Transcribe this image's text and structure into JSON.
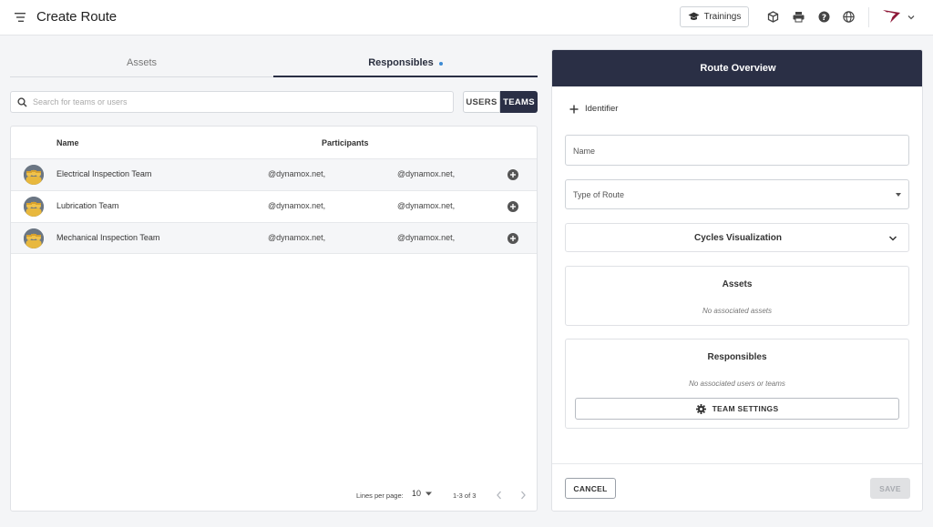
{
  "header": {
    "title": "Create Route",
    "trainings_label": "Trainings",
    "icons": [
      "menu-icon",
      "cube-icon",
      "printer-icon",
      "help-icon",
      "globe-icon",
      "brand-logo",
      "chevron-down-icon"
    ]
  },
  "left": {
    "tabs": [
      {
        "label": "Assets",
        "active": false
      },
      {
        "label": "Responsibles",
        "active": true
      }
    ],
    "search": {
      "placeholder": "Search for teams or users"
    },
    "toggle": {
      "users": "USERS",
      "teams": "TEAMS",
      "selected": "TEAMS"
    },
    "table": {
      "columns": {
        "name": "Name",
        "participants": "Participants"
      },
      "rows": [
        {
          "name": "Electrical Inspection Team",
          "participant_1": "@dynamox.net,",
          "participant_2": "@dynamox.net,"
        },
        {
          "name": "Lubrication Team",
          "participant_1": "@dynamox.net,",
          "participant_2": "@dynamox.net,"
        },
        {
          "name": "Mechanical Inspection Team",
          "participant_1": "@dynamox.net,",
          "participant_2": "@dynamox.net,"
        }
      ]
    },
    "pagination": {
      "lines_label": "Lines per page:",
      "lines_value": "10",
      "range": "1-3 of 3"
    }
  },
  "right": {
    "header": "Route Overview",
    "identifier_label": "Identifier",
    "name_placeholder": "Name",
    "type_label": "Type of Route",
    "cycles_label": "Cycles Visualization",
    "assets": {
      "title": "Assets",
      "empty": "No associated assets"
    },
    "responsibles": {
      "title": "Responsibles",
      "empty": "No associated users or teams",
      "button": "TEAM SETTINGS"
    },
    "cancel": "CANCEL",
    "save": "SAVE"
  },
  "colors": {
    "navy": "#2a2f45",
    "accent_dot": "#3d8bd4",
    "brand_logo": "#8e1838"
  }
}
